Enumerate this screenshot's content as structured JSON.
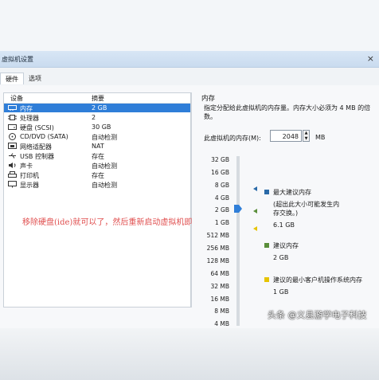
{
  "window": {
    "title": "虚拟机设置",
    "close_glyph": "×"
  },
  "tabs": [
    {
      "label": "硬件"
    },
    {
      "label": "选项"
    }
  ],
  "device_list": {
    "col_device": "设备",
    "col_summary": "摘要",
    "rows": [
      {
        "icon": "memory-icon",
        "name": "内存",
        "summary": "2 GB",
        "selected": true
      },
      {
        "icon": "cpu-icon",
        "name": "处理器",
        "summary": "2"
      },
      {
        "icon": "disk-icon",
        "name": "硬盘 (SCSI)",
        "summary": "30 GB"
      },
      {
        "icon": "cdrom-icon",
        "name": "CD/DVD (SATA)",
        "summary": "自动检测"
      },
      {
        "icon": "network-icon",
        "name": "网络适配器",
        "summary": "NAT"
      },
      {
        "icon": "usb-icon",
        "name": "USB 控制器",
        "summary": "存在"
      },
      {
        "icon": "sound-icon",
        "name": "声卡",
        "summary": "自动检测"
      },
      {
        "icon": "printer-icon",
        "name": "打印机",
        "summary": "存在"
      },
      {
        "icon": "display-icon",
        "name": "显示器",
        "summary": "自动检测"
      }
    ]
  },
  "memory": {
    "section_title": "内存",
    "description": "指定分配给此虚拟机的内存量。内存大小必须为 4 MB 的倍数。",
    "field_label": "此虚拟机的内存(M):",
    "value": "2048",
    "unit": "MB",
    "scale": [
      "32 GB",
      "16 GB",
      "8 GB",
      "4 GB",
      "2 GB",
      "1 GB",
      "512 MB",
      "256 MB",
      "128 MB",
      "64 MB",
      "32 MB",
      "16 MB",
      "8 MB",
      "4 MB"
    ],
    "legend": {
      "max_label": "最大建议内存",
      "max_note": "(超出此大小可能发生内存交换。)",
      "max_value": "6.1 GB",
      "rec_label": "建议内存",
      "rec_value": "2 GB",
      "min_label": "建议的最小客户机操作系统内存",
      "min_value": "1 GB"
    },
    "colors": {
      "max": "#2a6aa8",
      "rec": "#5a8e3a",
      "min": "#e6c400",
      "accent": "#2f7ed8"
    }
  },
  "overlay_text": "移除硬盘(ide)就可以了，然后重新启动虚拟机即",
  "watermark": "头条 @义县游学电子科技"
}
